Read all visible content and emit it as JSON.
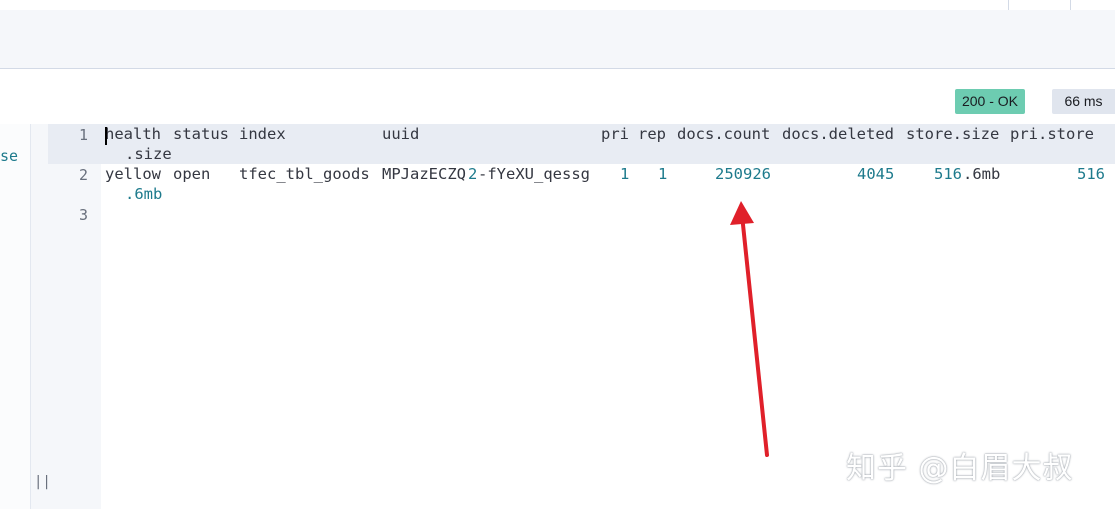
{
  "response": {
    "status_badge": "200 - OK",
    "time_badge": "66 ms",
    "left_snippet": "se"
  },
  "editor": {
    "line_numbers": [
      "1",
      "2",
      "3"
    ],
    "header": {
      "health": "health",
      "status": "status",
      "index": "index",
      "uuid": "uuid",
      "pri": "pri",
      "rep": "rep",
      "docs_count": "docs.count",
      "docs_deleted": "docs.deleted",
      "store_size": "store.size",
      "pri_store": "pri.store",
      "pri_store_wrap": ".size"
    },
    "row": {
      "health": "yellow",
      "status": "open",
      "index": "tfec_tbl_goods",
      "uuid_a": "MPJazECZQ",
      "uuid_b": "2",
      "uuid_c": "-fYeXU_qessg",
      "pri": "1",
      "rep": "1",
      "docs_count": "250926",
      "docs_deleted": "4045",
      "store_size_num": "516",
      "store_size_unit": ".6mb",
      "pri_store": "516",
      "pri_store_wrap": ".6mb"
    }
  },
  "panel": {
    "resize_handle": "||"
  },
  "watermark": "知乎 @白眉大叔",
  "colors": {
    "ok_badge": "#6dccb1",
    "time_badge": "#e0e5ee",
    "number": "#1d7a8c",
    "arrow": "#e0202a"
  },
  "icons": {
    "resize_handle": "resize-handle-icon",
    "arrow": "arrow-annotation"
  }
}
